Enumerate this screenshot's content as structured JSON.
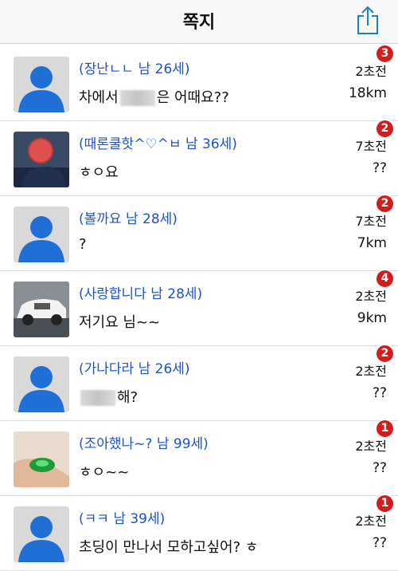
{
  "header": {
    "title": "쪽지",
    "action_icon": "share-icon"
  },
  "colors": {
    "name": "#1e52c9",
    "badge": "#d91a1a",
    "avatar_bg": "#d9d9d9",
    "avatar_fg": "#1f6fd6"
  },
  "messages": [
    {
      "name": "(장난ㄴㄴ 남 26세)",
      "text_before": "차에서",
      "text_after": "은 어때요??",
      "time": "2초전",
      "distance": "18km",
      "badge": "3",
      "avatar": "default"
    },
    {
      "name": "(때론쿨핫^♡^ㅂ 남 36세)",
      "text_before": "ㅎㅇ요",
      "text_after": "",
      "time": "7초전",
      "distance": "??",
      "badge": "2",
      "avatar": "photo-person"
    },
    {
      "name": "(볼까요 남 28세)",
      "text_before": "?",
      "text_after": "",
      "time": "7초전",
      "distance": "7km",
      "badge": "2",
      "avatar": "default"
    },
    {
      "name": "(사랑합니다 남 28세)",
      "text_before": "저기요 님~~",
      "text_after": "",
      "time": "2초전",
      "distance": "9km",
      "badge": "4",
      "avatar": "photo-car"
    },
    {
      "name": "(가나다라 남 26세)",
      "text_before": "",
      "text_after": "해?",
      "time": "2초전",
      "distance": "??",
      "badge": "2",
      "avatar": "default"
    },
    {
      "name": "(조아했나~? 남 99세)",
      "text_before": "ㅎㅇ~~",
      "text_after": "",
      "time": "2초전",
      "distance": "??",
      "badge": "1",
      "avatar": "photo-ring"
    },
    {
      "name": "(ㅋㅋ 남 39세)",
      "text_before": "초딩이 만나서 모하고싶어? ㅎ",
      "text_after": "",
      "time": "2초전",
      "distance": "??",
      "badge": "1",
      "avatar": "default"
    }
  ]
}
